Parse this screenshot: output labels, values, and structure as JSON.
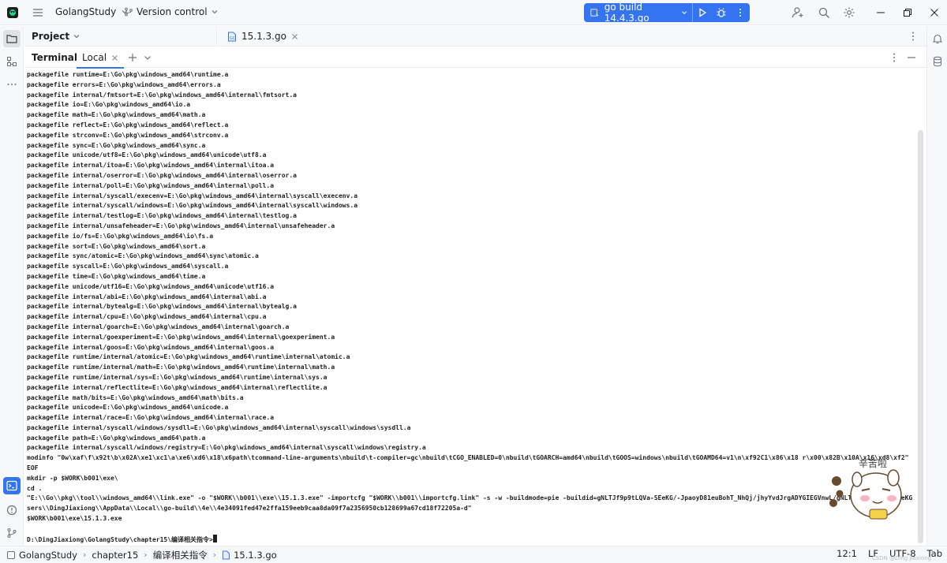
{
  "titlebar": {
    "project_name": "GolangStudy",
    "vcs_label": "Version control",
    "run_config": "go build 14.4.3.go"
  },
  "project_panel": {
    "title": "Project"
  },
  "editor": {
    "tabs": [
      {
        "label": "15.1.3.go"
      }
    ]
  },
  "terminal": {
    "title": "Terminal",
    "tab_label": "Local",
    "lines": [
      "packagefile runtime=E:\\Go\\pkg\\windows_amd64\\runtime.a",
      "packagefile errors=E:\\Go\\pkg\\windows_amd64\\errors.a",
      "packagefile internal/fmtsort=E:\\Go\\pkg\\windows_amd64\\internal\\fmtsort.a",
      "packagefile io=E:\\Go\\pkg\\windows_amd64\\io.a",
      "packagefile math=E:\\Go\\pkg\\windows_amd64\\math.a",
      "packagefile reflect=E:\\Go\\pkg\\windows_amd64\\reflect.a",
      "packagefile strconv=E:\\Go\\pkg\\windows_amd64\\strconv.a",
      "packagefile sync=E:\\Go\\pkg\\windows_amd64\\sync.a",
      "packagefile unicode/utf8=E:\\Go\\pkg\\windows_amd64\\unicode\\utf8.a",
      "packagefile internal/itoa=E:\\Go\\pkg\\windows_amd64\\internal\\itoa.a",
      "packagefile internal/oserror=E:\\Go\\pkg\\windows_amd64\\internal\\oserror.a",
      "packagefile internal/poll=E:\\Go\\pkg\\windows_amd64\\internal\\poll.a",
      "packagefile internal/syscall/execenv=E:\\Go\\pkg\\windows_amd64\\internal\\syscall\\execenv.a",
      "packagefile internal/syscall/windows=E:\\Go\\pkg\\windows_amd64\\internal\\syscall\\windows.a",
      "packagefile internal/testlog=E:\\Go\\pkg\\windows_amd64\\internal\\testlog.a",
      "packagefile internal/unsafeheader=E:\\Go\\pkg\\windows_amd64\\internal\\unsafeheader.a",
      "packagefile io/fs=E:\\Go\\pkg\\windows_amd64\\io\\fs.a",
      "packagefile sort=E:\\Go\\pkg\\windows_amd64\\sort.a",
      "packagefile sync/atomic=E:\\Go\\pkg\\windows_amd64\\sync\\atomic.a",
      "packagefile syscall=E:\\Go\\pkg\\windows_amd64\\syscall.a",
      "packagefile time=E:\\Go\\pkg\\windows_amd64\\time.a",
      "packagefile unicode/utf16=E:\\Go\\pkg\\windows_amd64\\unicode\\utf16.a",
      "packagefile internal/abi=E:\\Go\\pkg\\windows_amd64\\internal\\abi.a",
      "packagefile internal/bytealg=E:\\Go\\pkg\\windows_amd64\\internal\\bytealg.a",
      "packagefile internal/cpu=E:\\Go\\pkg\\windows_amd64\\internal\\cpu.a",
      "packagefile internal/goarch=E:\\Go\\pkg\\windows_amd64\\internal\\goarch.a",
      "packagefile internal/goexperiment=E:\\Go\\pkg\\windows_amd64\\internal\\goexperiment.a",
      "packagefile internal/goos=E:\\Go\\pkg\\windows_amd64\\internal\\goos.a",
      "packagefile runtime/internal/atomic=E:\\Go\\pkg\\windows_amd64\\runtime\\internal\\atomic.a",
      "packagefile runtime/internal/math=E:\\Go\\pkg\\windows_amd64\\runtime\\internal\\math.a",
      "packagefile runtime/internal/sys=E:\\Go\\pkg\\windows_amd64\\runtime\\internal\\sys.a",
      "packagefile internal/reflectlite=E:\\Go\\pkg\\windows_amd64\\internal\\reflectlite.a",
      "packagefile math/bits=E:\\Go\\pkg\\windows_amd64\\math\\bits.a",
      "packagefile unicode=E:\\Go\\pkg\\windows_amd64\\unicode.a",
      "packagefile internal/race=E:\\Go\\pkg\\windows_amd64\\internal\\race.a",
      "packagefile internal/syscall/windows/sysdll=E:\\Go\\pkg\\windows_amd64\\internal\\syscall\\windows\\sysdll.a",
      "packagefile path=E:\\Go\\pkg\\windows_amd64\\path.a",
      "packagefile internal/syscall/windows/registry=E:\\Go\\pkg\\windows_amd64\\internal\\syscall\\windows\\registry.a",
      "modinfo \"0w\\xaf\\f\\x92t\\b\\x02A\\xe1\\xc1\\a\\xe6\\xd6\\x18\\x6path\\tcommand-line-arguments\\nbuild\\t-compiler=gc\\nbuild\\tCGO_ENABLED=0\\nbuild\\tGOARCH=amd64\\nbuild\\tGOOS=windows\\nbuild\\tGOAMD64=v1\\n\\xf92C1\\x86\\x18 r\\x00\\x82B\\x10A\\x16\\xd8\\xf2\"",
      "EOF",
      "mkdir -p $WORK\\b001\\exe\\",
      "cd .",
      "\"E:\\\\Go\\\\pkg\\\\tool\\\\windows_amd64\\\\link.exe\" -o \"$WORK\\\\b001\\\\exe\\\\15.1.3.exe\" -importcfg \"$WORK\\\\b001\\\\importcfg.link\" -s -w -buildmode=pie -buildid=gNLTJf9p9tLQVa-SEeKG/-JpaoyD81euBohT_NhQj/jhyYvdJrgADYGIEGVnwL/gNLTJf9p9tLQVa-SEeKG -extld=gcc \"C:\\\\U",
      "sers\\\\DingJiaxiong\\\\AppData\\\\Local\\\\go-build\\\\4e\\\\4e34091fed47e2ffa159eeb9caa8da09f7a2356950cb128699a67cd18f72205a-d\"",
      "$WORK\\b001\\exe\\15.1.3.exe",
      "",
      "D:\\DingJiaxiong\\GolangStudy\\chapter15\\编译相关指令>"
    ]
  },
  "sticker": {
    "text": "辛苦啦"
  },
  "statusbar": {
    "crumbs": [
      "GolangStudy",
      "chapter15",
      "编译相关指令",
      "15.1.3.go"
    ],
    "position": "12:1",
    "line_sep": "LF",
    "encoding": "UTF-8",
    "indent": "Tab"
  },
  "watermark": "CSDN @Ding Jiaxiong",
  "colors": {
    "accent": "#3574f0",
    "background": "#ffffff",
    "panel": "#f7f8fa",
    "border": "#ebecf0"
  }
}
